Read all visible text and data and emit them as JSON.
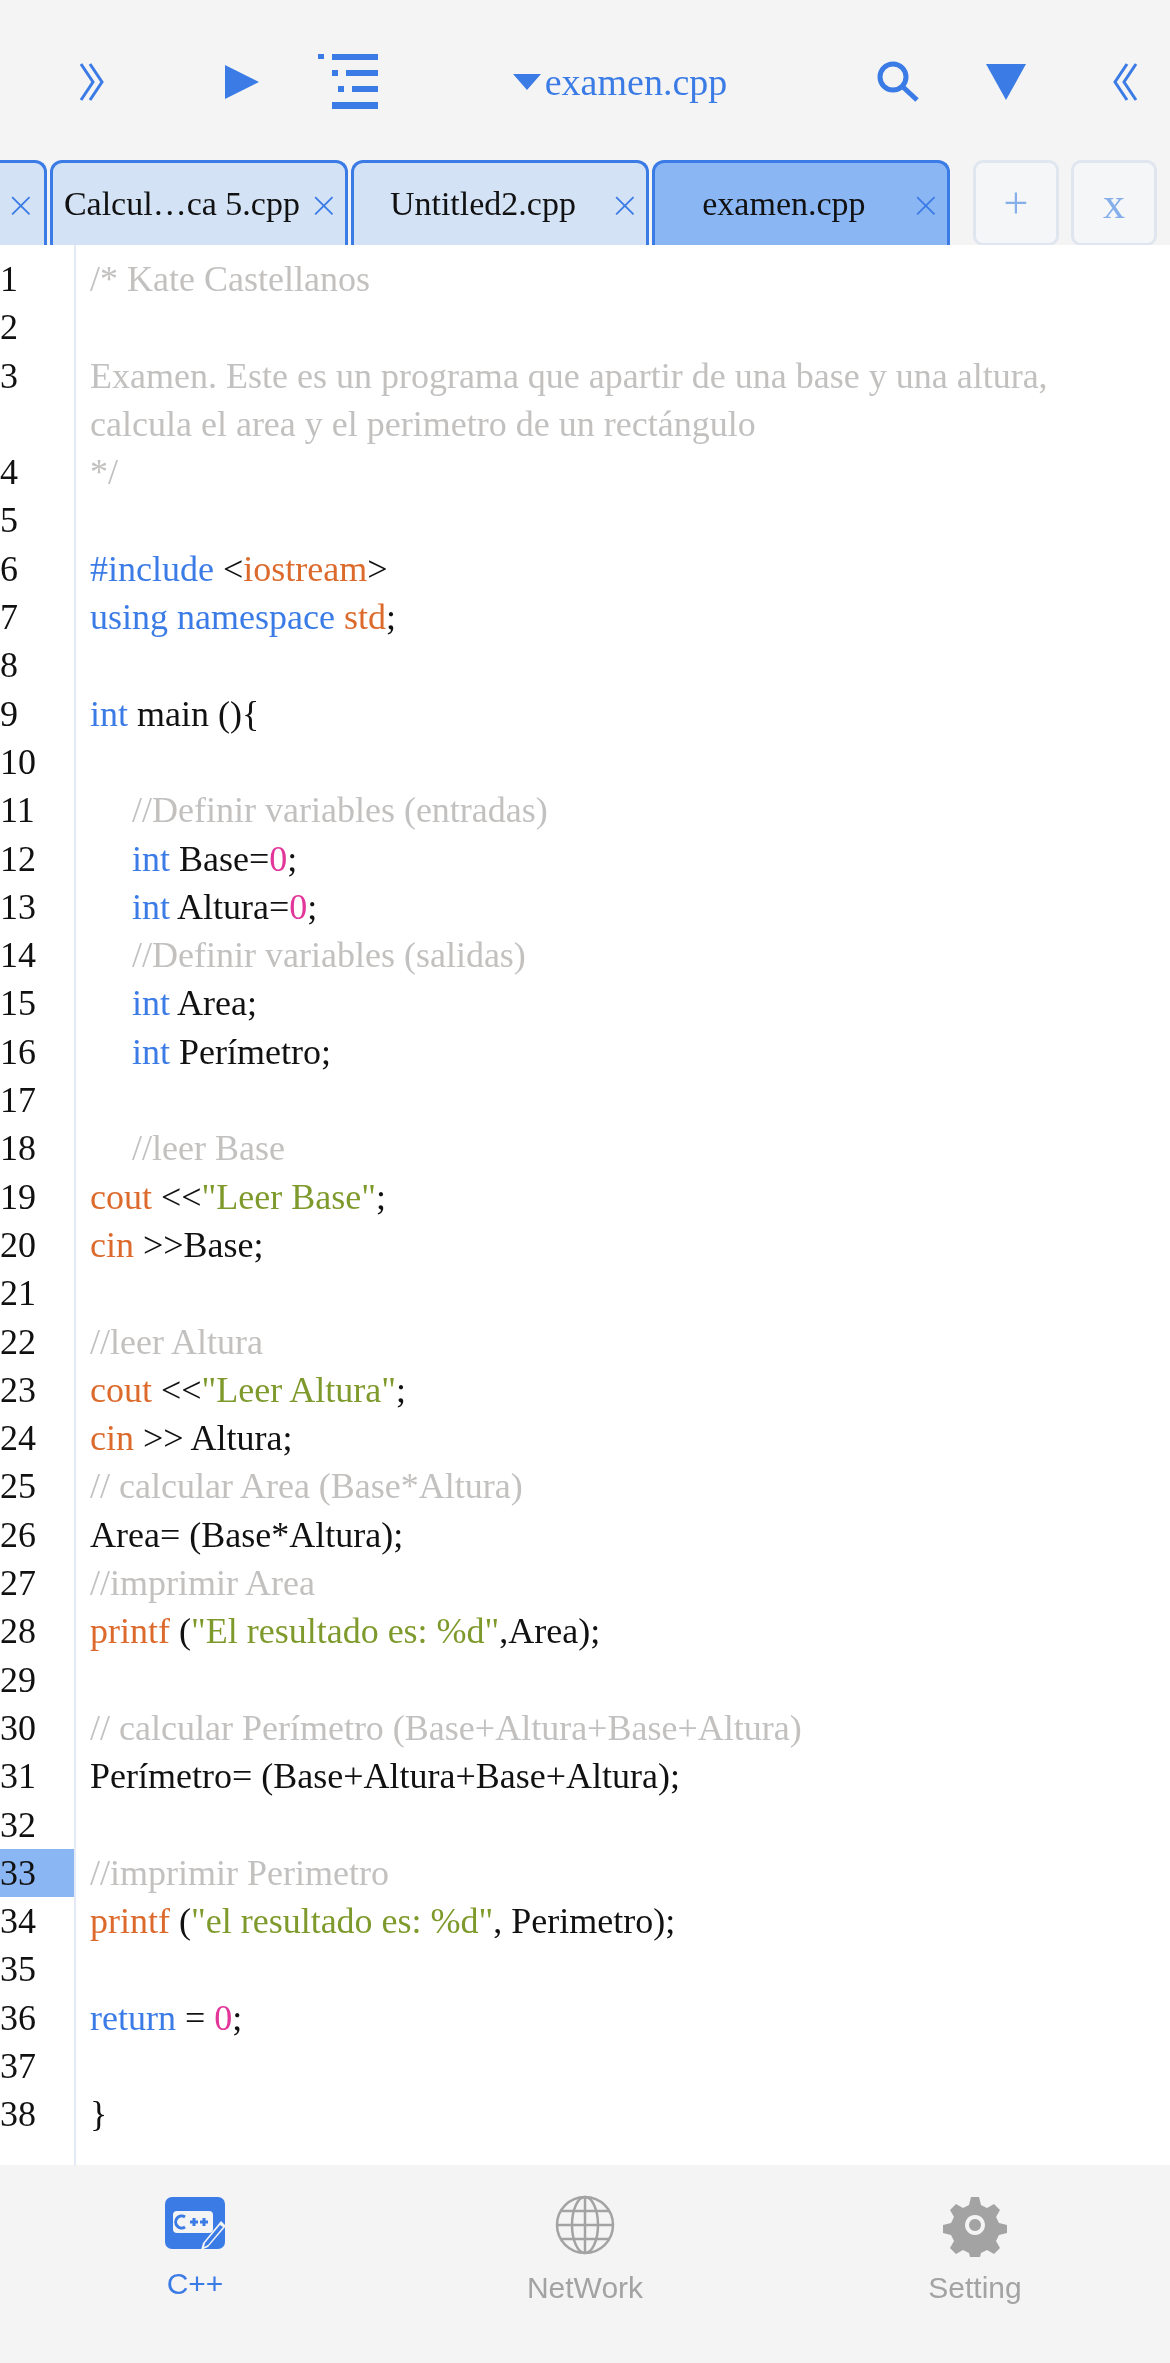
{
  "toolbar": {
    "title": "examen.cpp"
  },
  "tabs": [
    {
      "close": "×",
      "selected": false
    },
    {
      "label": "Calcul…ca 5.cpp",
      "close": "×",
      "selected": false
    },
    {
      "label": "Untitled2.cpp",
      "close": "×",
      "selected": false
    },
    {
      "label": "examen.cpp",
      "close": "×",
      "selected": true
    }
  ],
  "tab_actions": [
    "+",
    "x"
  ],
  "editor": {
    "lines": [
      {
        "n": "1",
        "current": false,
        "indented": false,
        "tokens": [
          {
            "kind": "comment",
            "t": "/* Kate Castellanos"
          }
        ]
      },
      {
        "n": "2",
        "current": false
      },
      {
        "n": "3",
        "current": false,
        "indented": false,
        "tokens": [
          {
            "kind": "comment",
            "t": "Examen. Este es un programa que apartir de una base y una altura, calcula el area y el perimetro de un rectángulo"
          }
        ]
      },
      {
        "n": "4",
        "current": false,
        "indented": false,
        "tokens": [
          {
            "kind": "comment",
            "t": "*/"
          }
        ]
      },
      {
        "n": "5",
        "current": false
      },
      {
        "n": "6",
        "current": false,
        "indented": false,
        "tokens": [
          {
            "kind": "keyword",
            "t": "#include"
          },
          {
            "kind": "plain",
            "t": " <"
          },
          {
            "kind": "builtin",
            "t": "iostream"
          },
          {
            "kind": "plain",
            "t": ">"
          }
        ]
      },
      {
        "n": "7",
        "current": false,
        "indented": false,
        "tokens": [
          {
            "kind": "keyword",
            "t": "using namespace "
          },
          {
            "kind": "builtin",
            "t": "std"
          },
          {
            "kind": "plain",
            "t": ";"
          }
        ]
      },
      {
        "n": "8",
        "current": false
      },
      {
        "n": "9",
        "current": false,
        "indented": false,
        "tokens": [
          {
            "kind": "keyword",
            "t": "int"
          },
          {
            "kind": "plain",
            "t": " main (){"
          }
        ]
      },
      {
        "n": "10",
        "current": false
      },
      {
        "n": "11",
        "current": false,
        "indented": true,
        "tokens": [
          {
            "kind": "comment",
            "t": "//Definir variables (entradas)"
          }
        ]
      },
      {
        "n": "12",
        "current": false,
        "indented": true,
        "tokens": [
          {
            "kind": "keyword",
            "t": "int"
          },
          {
            "kind": "plain",
            "t": " Base="
          },
          {
            "kind": "number",
            "t": "0"
          },
          {
            "kind": "plain",
            "t": ";"
          }
        ]
      },
      {
        "n": "13",
        "current": false,
        "indented": true,
        "tokens": [
          {
            "kind": "keyword",
            "t": "int"
          },
          {
            "kind": "plain",
            "t": " Altura="
          },
          {
            "kind": "number",
            "t": "0"
          },
          {
            "kind": "plain",
            "t": ";"
          }
        ]
      },
      {
        "n": "14",
        "current": false,
        "indented": true,
        "tokens": [
          {
            "kind": "comment",
            "t": "//Definir variables (salidas)"
          }
        ]
      },
      {
        "n": "15",
        "current": false,
        "indented": true,
        "tokens": [
          {
            "kind": "keyword",
            "t": "int"
          },
          {
            "kind": "plain",
            "t": " Area;"
          }
        ]
      },
      {
        "n": "16",
        "current": false,
        "indented": true,
        "tokens": [
          {
            "kind": "keyword",
            "t": "int"
          },
          {
            "kind": "plain",
            "t": " Perímetro;"
          }
        ]
      },
      {
        "n": "17",
        "current": false
      },
      {
        "n": "18",
        "current": false,
        "indented": true,
        "tokens": [
          {
            "kind": "comment",
            "t": "//leer Base"
          }
        ]
      },
      {
        "n": "19",
        "current": false,
        "indented": false,
        "tokens": [
          {
            "kind": "builtin",
            "t": "cout"
          },
          {
            "kind": "plain",
            "t": " <<"
          },
          {
            "kind": "string",
            "t": "\"Leer Base\""
          },
          {
            "kind": "plain",
            "t": ";"
          }
        ]
      },
      {
        "n": "20",
        "current": false,
        "indented": false,
        "tokens": [
          {
            "kind": "builtin",
            "t": "cin"
          },
          {
            "kind": "plain",
            "t": " >>Base;"
          }
        ]
      },
      {
        "n": "21",
        "current": false
      },
      {
        "n": "22",
        "current": false,
        "indented": false,
        "tokens": [
          {
            "kind": "comment",
            "t": "//leer Altura"
          }
        ]
      },
      {
        "n": "23",
        "current": false,
        "indented": false,
        "tokens": [
          {
            "kind": "builtin",
            "t": "cout"
          },
          {
            "kind": "plain",
            "t": " <<"
          },
          {
            "kind": "string",
            "t": "\"Leer Altura\""
          },
          {
            "kind": "plain",
            "t": ";"
          }
        ]
      },
      {
        "n": "24",
        "current": false,
        "indented": false,
        "tokens": [
          {
            "kind": "builtin",
            "t": "cin"
          },
          {
            "kind": "plain",
            "t": " >> Altura;"
          }
        ]
      },
      {
        "n": "25",
        "current": false,
        "indented": false,
        "tokens": [
          {
            "kind": "comment",
            "t": "// calcular Area (Base*Altura)"
          }
        ]
      },
      {
        "n": "26",
        "current": false,
        "indented": false,
        "tokens": [
          {
            "kind": "plain",
            "t": "Area= (Base*Altura);"
          }
        ]
      },
      {
        "n": "27",
        "current": false,
        "indented": false,
        "tokens": [
          {
            "kind": "comment",
            "t": "//imprimir Area"
          }
        ]
      },
      {
        "n": "28",
        "current": false,
        "indented": false,
        "tokens": [
          {
            "kind": "builtin",
            "t": "printf"
          },
          {
            "kind": "plain",
            "t": " ("
          },
          {
            "kind": "string",
            "t": "\"El resultado es: %d\""
          },
          {
            "kind": "plain",
            "t": ",Area);"
          }
        ]
      },
      {
        "n": "29",
        "current": false
      },
      {
        "n": "30",
        "current": false,
        "indented": false,
        "tokens": [
          {
            "kind": "comment",
            "t": "// calcular Perímetro (Base+Altura+Base+Altura)"
          }
        ]
      },
      {
        "n": "31",
        "current": false,
        "indented": false,
        "tokens": [
          {
            "kind": "plain",
            "t": "Perímetro= (Base+Altura+Base+Altura);"
          }
        ]
      },
      {
        "n": "32",
        "current": false
      },
      {
        "n": "33",
        "current": true,
        "indented": false,
        "tokens": [
          {
            "kind": "comment",
            "t": "//imprimir Perimetro"
          }
        ]
      },
      {
        "n": "34",
        "current": false,
        "indented": false,
        "tokens": [
          {
            "kind": "builtin",
            "t": "printf"
          },
          {
            "kind": "plain",
            "t": " ("
          },
          {
            "kind": "string",
            "t": "\"el resultado es: %d\""
          },
          {
            "kind": "plain",
            "t": ", Perimetro);"
          }
        ]
      },
      {
        "n": "35",
        "current": false
      },
      {
        "n": "36",
        "current": false,
        "indented": false,
        "tokens": [
          {
            "kind": "keyword",
            "t": "return"
          },
          {
            "kind": "plain",
            "t": " = "
          },
          {
            "kind": "number",
            "t": "0"
          },
          {
            "kind": "plain",
            "t": ";"
          }
        ]
      },
      {
        "n": "37",
        "current": false
      },
      {
        "n": "38",
        "current": false,
        "indented": false,
        "tokens": [
          {
            "kind": "plain",
            "t": "}"
          }
        ]
      }
    ]
  },
  "bottom_nav": [
    {
      "kind": "cpp",
      "label": "C++",
      "selected": true
    },
    {
      "kind": "globe",
      "label": "NetWork",
      "selected": false
    },
    {
      "kind": "gear",
      "label": "Setting",
      "selected": false
    }
  ]
}
